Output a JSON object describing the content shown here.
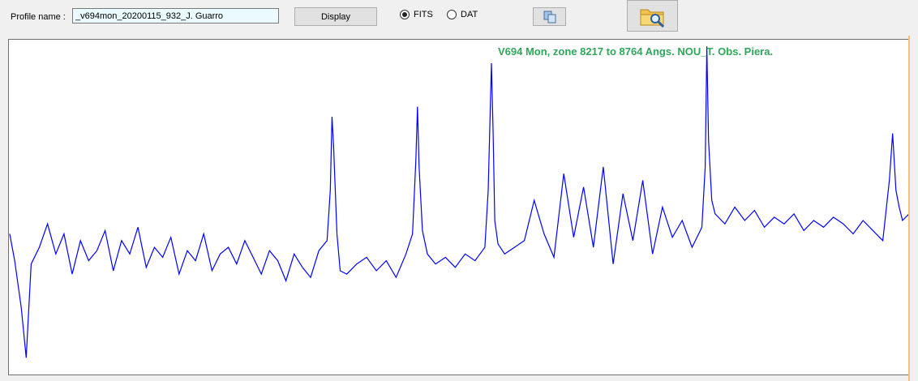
{
  "toolbar": {
    "profile_label": "Profile name :",
    "profile_value": "_v694mon_20200115_932_J. Guarro",
    "display_label": "Display",
    "format_options": [
      {
        "label": "FITS",
        "selected": true
      },
      {
        "label": "DAT",
        "selected": false
      }
    ],
    "copy_icon": "copy-icon",
    "open_icon": "folder-search-icon"
  },
  "colors": {
    "title": "#2fa65a",
    "line": "#0000ff"
  },
  "chart_data": {
    "type": "line",
    "title": "V694 Mon, zone 8217 to 8764 Angs. NOU_T.  Obs. Piera.",
    "xlabel": "",
    "ylabel": "",
    "xlim": [
      8217,
      8764
    ],
    "ylim": [
      0,
      1
    ],
    "grid": false,
    "series": [
      {
        "x": [
          8217,
          8220,
          8224,
          8227,
          8230,
          8235,
          8240,
          8245,
          8250,
          8255,
          8260,
          8265,
          8270,
          8275,
          8280,
          8285,
          8290,
          8295,
          8300,
          8305,
          8310,
          8315,
          8320,
          8325,
          8330,
          8335,
          8340,
          8345,
          8350,
          8355,
          8360,
          8365,
          8370,
          8375,
          8380,
          8385,
          8390,
          8395,
          8400,
          8405,
          8410,
          8412,
          8413,
          8414,
          8416,
          8418,
          8422,
          8428,
          8434,
          8440,
          8446,
          8452,
          8458,
          8462,
          8464,
          8465,
          8466,
          8468,
          8471,
          8476,
          8482,
          8488,
          8494,
          8500,
          8506,
          8508,
          8510,
          8511,
          8512,
          8514,
          8518,
          8524,
          8530,
          8536,
          8542,
          8548,
          8554,
          8560,
          8566,
          8572,
          8578,
          8584,
          8590,
          8596,
          8602,
          8608,
          8614,
          8620,
          8626,
          8632,
          8638,
          8640,
          8641,
          8642,
          8644,
          8646,
          8652,
          8658,
          8664,
          8670,
          8676,
          8682,
          8688,
          8694,
          8700,
          8706,
          8712,
          8718,
          8724,
          8730,
          8736,
          8742,
          8748,
          8752,
          8754,
          8756,
          8758,
          8760,
          8764
        ],
        "y": [
          0.42,
          0.34,
          0.2,
          0.05,
          0.33,
          0.38,
          0.45,
          0.36,
          0.42,
          0.3,
          0.4,
          0.34,
          0.37,
          0.43,
          0.31,
          0.4,
          0.36,
          0.44,
          0.32,
          0.38,
          0.35,
          0.41,
          0.3,
          0.37,
          0.34,
          0.42,
          0.31,
          0.36,
          0.38,
          0.33,
          0.4,
          0.35,
          0.3,
          0.37,
          0.34,
          0.28,
          0.36,
          0.32,
          0.29,
          0.37,
          0.4,
          0.55,
          0.77,
          0.68,
          0.42,
          0.31,
          0.3,
          0.33,
          0.35,
          0.31,
          0.34,
          0.29,
          0.36,
          0.42,
          0.64,
          0.8,
          0.62,
          0.43,
          0.36,
          0.33,
          0.35,
          0.32,
          0.36,
          0.34,
          0.38,
          0.55,
          0.93,
          0.72,
          0.46,
          0.39,
          0.36,
          0.38,
          0.4,
          0.52,
          0.42,
          0.35,
          0.6,
          0.41,
          0.56,
          0.38,
          0.62,
          0.33,
          0.54,
          0.4,
          0.58,
          0.36,
          0.5,
          0.41,
          0.46,
          0.38,
          0.44,
          0.62,
          0.98,
          0.7,
          0.52,
          0.48,
          0.45,
          0.5,
          0.46,
          0.49,
          0.44,
          0.47,
          0.45,
          0.48,
          0.43,
          0.46,
          0.44,
          0.47,
          0.45,
          0.42,
          0.46,
          0.43,
          0.4,
          0.58,
          0.72,
          0.55,
          0.5,
          0.46,
          0.48
        ]
      }
    ]
  }
}
